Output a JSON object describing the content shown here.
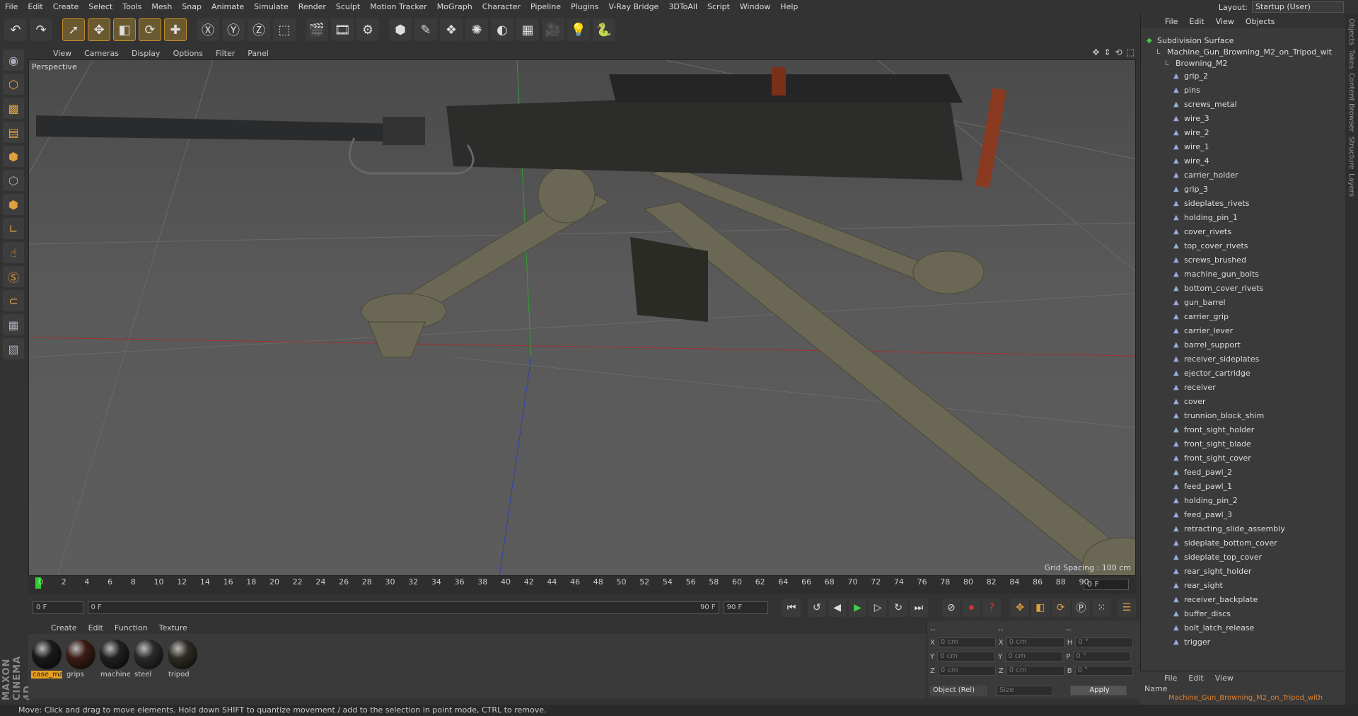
{
  "menubar": [
    "File",
    "Edit",
    "Create",
    "Select",
    "Tools",
    "Mesh",
    "Snap",
    "Animate",
    "Simulate",
    "Render",
    "Sculpt",
    "Motion Tracker",
    "MoGraph",
    "Character",
    "Pipeline",
    "Plugins",
    "V-Ray Bridge",
    "3DToAll",
    "Script",
    "Window",
    "Help"
  ],
  "layout": {
    "label": "Layout:",
    "value": "Startup (User)"
  },
  "viewport": {
    "menu": [
      "View",
      "Cameras",
      "Display",
      "Options",
      "Filter",
      "Panel"
    ],
    "label": "Perspective",
    "grid_spacing": "Grid Spacing : 100 cm"
  },
  "timeline": {
    "ticks": [
      "0",
      "2",
      "4",
      "6",
      "8",
      "10",
      "12",
      "14",
      "16",
      "18",
      "20",
      "22",
      "24",
      "26",
      "28",
      "30",
      "32",
      "34",
      "36",
      "38",
      "40",
      "42",
      "44",
      "46",
      "48",
      "50",
      "52",
      "54",
      "56",
      "58",
      "60",
      "62",
      "64",
      "66",
      "68",
      "70",
      "72",
      "74",
      "76",
      "78",
      "80",
      "82",
      "84",
      "86",
      "88",
      "90"
    ],
    "frame_field": "0 F"
  },
  "transport": {
    "start": "0 F",
    "range_start": "0 F",
    "range_end": "90 F",
    "end": "90 F"
  },
  "materials": {
    "menu": [
      "Create",
      "Edit",
      "Function",
      "Texture"
    ],
    "items": [
      {
        "name": "case_ma",
        "color": "#1a1a1a",
        "selected": true
      },
      {
        "name": "grips",
        "color": "#3a1c14",
        "selected": false
      },
      {
        "name": "machine",
        "color": "#202020",
        "selected": false
      },
      {
        "name": "steel",
        "color": "#2a2a2a",
        "selected": false
      },
      {
        "name": "tripod",
        "color": "#2e2c24",
        "selected": false
      }
    ]
  },
  "coords": {
    "header": [
      "--",
      "--",
      "--"
    ],
    "rows": [
      {
        "a": "X",
        "av": "0 cm",
        "b": "X",
        "bv": "0 cm",
        "c": "H",
        "cv": "0 °"
      },
      {
        "a": "Y",
        "av": "0 cm",
        "b": "Y",
        "bv": "0 cm",
        "c": "P",
        "cv": "0 °"
      },
      {
        "a": "Z",
        "av": "0 cm",
        "b": "Z",
        "bv": "0 cm",
        "c": "B",
        "cv": "0 °"
      }
    ],
    "mode": "Object (Rel)",
    "size": "Size",
    "apply": "Apply"
  },
  "objects": {
    "menu": [
      "File",
      "Edit",
      "View",
      "Objects"
    ],
    "root": "Subdivision Surface",
    "group": "Machine_Gun_Browning_M2_on_Tripod_wit",
    "sub": "Browning_M2",
    "items": [
      "grip_2",
      "pins",
      "screws_metal",
      "wire_3",
      "wire_2",
      "wire_1",
      "wire_4",
      "carrier_holder",
      "grip_3",
      "sideplates_rivets",
      "holding_pin_1",
      "cover_rivets",
      "top_cover_rivets",
      "screws_brushed",
      "machine_gun_bolts",
      "bottom_cover_rivets",
      "gun_barrel",
      "carrier_grip",
      "carrier_lever",
      "barrel_support",
      "receiver_sideplates",
      "ejector_cartridge",
      "receiver",
      "cover",
      "trunnion_block_shim",
      "front_sight_holder",
      "front_sight_blade",
      "front_sight_cover",
      "feed_pawl_2",
      "feed_pawl_1",
      "holding_pin_2",
      "feed_pawl_3",
      "retracting_slide_assembly",
      "sideplate_bottom_cover",
      "sideplate_top_cover",
      "rear_sight_holder",
      "rear_sight",
      "receiver_backplate",
      "buffer_discs",
      "bolt_latch_release",
      "trigger"
    ]
  },
  "layers": {
    "menu": [
      "File",
      "Edit",
      "View"
    ],
    "name_header": "Name",
    "row": "Machine_Gun_Browning_M2_on_Tripod_with"
  },
  "right_tabs": [
    "Objects",
    "Takes",
    "Content Browser",
    "Structure",
    "Layers"
  ],
  "status": "Move: Click and drag to move elements. Hold down SHIFT to quantize movement / add to the selection in point mode, CTRL to remove.",
  "brand": "MAXON CINEMA 4D"
}
